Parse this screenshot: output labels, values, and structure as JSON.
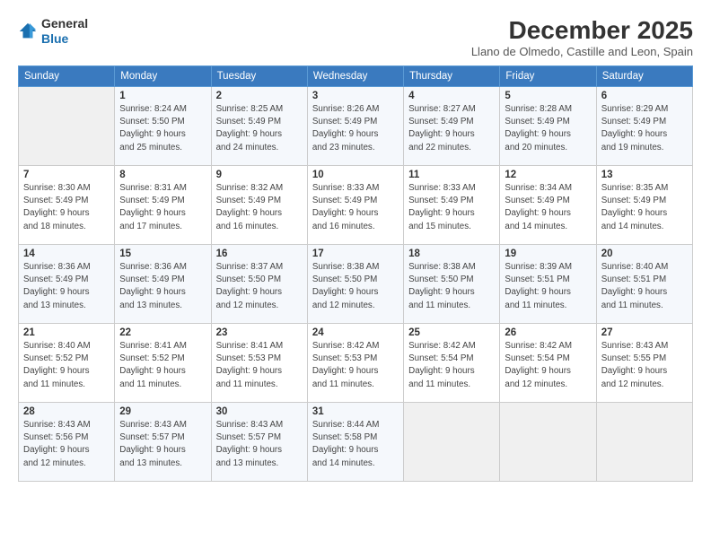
{
  "header": {
    "logo_general": "General",
    "logo_blue": "Blue",
    "month_title": "December 2025",
    "location": "Llano de Olmedo, Castille and Leon, Spain"
  },
  "days_of_week": [
    "Sunday",
    "Monday",
    "Tuesday",
    "Wednesday",
    "Thursday",
    "Friday",
    "Saturday"
  ],
  "weeks": [
    [
      {
        "day": "",
        "info": ""
      },
      {
        "day": "1",
        "info": "Sunrise: 8:24 AM\nSunset: 5:50 PM\nDaylight: 9 hours\nand 25 minutes."
      },
      {
        "day": "2",
        "info": "Sunrise: 8:25 AM\nSunset: 5:49 PM\nDaylight: 9 hours\nand 24 minutes."
      },
      {
        "day": "3",
        "info": "Sunrise: 8:26 AM\nSunset: 5:49 PM\nDaylight: 9 hours\nand 23 minutes."
      },
      {
        "day": "4",
        "info": "Sunrise: 8:27 AM\nSunset: 5:49 PM\nDaylight: 9 hours\nand 22 minutes."
      },
      {
        "day": "5",
        "info": "Sunrise: 8:28 AM\nSunset: 5:49 PM\nDaylight: 9 hours\nand 20 minutes."
      },
      {
        "day": "6",
        "info": "Sunrise: 8:29 AM\nSunset: 5:49 PM\nDaylight: 9 hours\nand 19 minutes."
      }
    ],
    [
      {
        "day": "7",
        "info": "Sunrise: 8:30 AM\nSunset: 5:49 PM\nDaylight: 9 hours\nand 18 minutes."
      },
      {
        "day": "8",
        "info": "Sunrise: 8:31 AM\nSunset: 5:49 PM\nDaylight: 9 hours\nand 17 minutes."
      },
      {
        "day": "9",
        "info": "Sunrise: 8:32 AM\nSunset: 5:49 PM\nDaylight: 9 hours\nand 16 minutes."
      },
      {
        "day": "10",
        "info": "Sunrise: 8:33 AM\nSunset: 5:49 PM\nDaylight: 9 hours\nand 16 minutes."
      },
      {
        "day": "11",
        "info": "Sunrise: 8:33 AM\nSunset: 5:49 PM\nDaylight: 9 hours\nand 15 minutes."
      },
      {
        "day": "12",
        "info": "Sunrise: 8:34 AM\nSunset: 5:49 PM\nDaylight: 9 hours\nand 14 minutes."
      },
      {
        "day": "13",
        "info": "Sunrise: 8:35 AM\nSunset: 5:49 PM\nDaylight: 9 hours\nand 14 minutes."
      }
    ],
    [
      {
        "day": "14",
        "info": "Sunrise: 8:36 AM\nSunset: 5:49 PM\nDaylight: 9 hours\nand 13 minutes."
      },
      {
        "day": "15",
        "info": "Sunrise: 8:36 AM\nSunset: 5:49 PM\nDaylight: 9 hours\nand 13 minutes."
      },
      {
        "day": "16",
        "info": "Sunrise: 8:37 AM\nSunset: 5:50 PM\nDaylight: 9 hours\nand 12 minutes."
      },
      {
        "day": "17",
        "info": "Sunrise: 8:38 AM\nSunset: 5:50 PM\nDaylight: 9 hours\nand 12 minutes."
      },
      {
        "day": "18",
        "info": "Sunrise: 8:38 AM\nSunset: 5:50 PM\nDaylight: 9 hours\nand 11 minutes."
      },
      {
        "day": "19",
        "info": "Sunrise: 8:39 AM\nSunset: 5:51 PM\nDaylight: 9 hours\nand 11 minutes."
      },
      {
        "day": "20",
        "info": "Sunrise: 8:40 AM\nSunset: 5:51 PM\nDaylight: 9 hours\nand 11 minutes."
      }
    ],
    [
      {
        "day": "21",
        "info": "Sunrise: 8:40 AM\nSunset: 5:52 PM\nDaylight: 9 hours\nand 11 minutes."
      },
      {
        "day": "22",
        "info": "Sunrise: 8:41 AM\nSunset: 5:52 PM\nDaylight: 9 hours\nand 11 minutes."
      },
      {
        "day": "23",
        "info": "Sunrise: 8:41 AM\nSunset: 5:53 PM\nDaylight: 9 hours\nand 11 minutes."
      },
      {
        "day": "24",
        "info": "Sunrise: 8:42 AM\nSunset: 5:53 PM\nDaylight: 9 hours\nand 11 minutes."
      },
      {
        "day": "25",
        "info": "Sunrise: 8:42 AM\nSunset: 5:54 PM\nDaylight: 9 hours\nand 11 minutes."
      },
      {
        "day": "26",
        "info": "Sunrise: 8:42 AM\nSunset: 5:54 PM\nDaylight: 9 hours\nand 12 minutes."
      },
      {
        "day": "27",
        "info": "Sunrise: 8:43 AM\nSunset: 5:55 PM\nDaylight: 9 hours\nand 12 minutes."
      }
    ],
    [
      {
        "day": "28",
        "info": "Sunrise: 8:43 AM\nSunset: 5:56 PM\nDaylight: 9 hours\nand 12 minutes."
      },
      {
        "day": "29",
        "info": "Sunrise: 8:43 AM\nSunset: 5:57 PM\nDaylight: 9 hours\nand 13 minutes."
      },
      {
        "day": "30",
        "info": "Sunrise: 8:43 AM\nSunset: 5:57 PM\nDaylight: 9 hours\nand 13 minutes."
      },
      {
        "day": "31",
        "info": "Sunrise: 8:44 AM\nSunset: 5:58 PM\nDaylight: 9 hours\nand 14 minutes."
      },
      {
        "day": "",
        "info": ""
      },
      {
        "day": "",
        "info": ""
      },
      {
        "day": "",
        "info": ""
      }
    ]
  ]
}
